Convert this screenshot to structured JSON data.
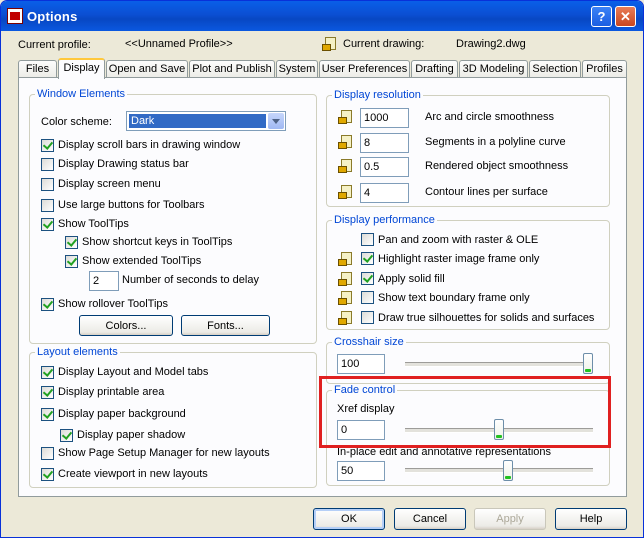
{
  "window": {
    "title": "Options",
    "help_glyph": "?",
    "close_glyph": "✕"
  },
  "profile": {
    "current_profile_label": "Current profile:",
    "current_profile_value": "<<Unnamed Profile>>",
    "current_drawing_label": "Current drawing:",
    "current_drawing_value": "Drawing2.dwg"
  },
  "tabs": [
    {
      "label": "Files"
    },
    {
      "label": "Display"
    },
    {
      "label": "Open and Save"
    },
    {
      "label": "Plot and Publish"
    },
    {
      "label": "System"
    },
    {
      "label": "User Preferences"
    },
    {
      "label": "Drafting"
    },
    {
      "label": "3D Modeling"
    },
    {
      "label": "Selection"
    },
    {
      "label": "Profiles"
    }
  ],
  "window_elements": {
    "title": "Window Elements",
    "color_scheme_label": "Color scheme:",
    "color_scheme_value": "Dark",
    "items": [
      {
        "label": "Display scroll bars in drawing window",
        "checked": true
      },
      {
        "label": "Display Drawing status bar",
        "checked": false
      },
      {
        "label": "Display screen menu",
        "checked": false
      },
      {
        "label": "Use large buttons for Toolbars",
        "checked": false
      },
      {
        "label": "Show ToolTips",
        "checked": true
      },
      {
        "label": "Show shortcut keys in ToolTips",
        "checked": true
      },
      {
        "label": "Show extended ToolTips",
        "checked": true
      },
      {
        "label": "Show rollover ToolTips",
        "checked": true
      }
    ],
    "seconds_value": "2",
    "seconds_label": "Number of seconds to delay",
    "colors_button": "Colors...",
    "fonts_button": "Fonts..."
  },
  "layout_elements": {
    "title": "Layout elements",
    "items": [
      {
        "label": "Display Layout and Model tabs",
        "checked": true
      },
      {
        "label": "Display printable area",
        "checked": true
      },
      {
        "label": "Display paper background",
        "checked": true
      },
      {
        "label": "Display paper shadow",
        "checked": true
      },
      {
        "label": "Show Page Setup Manager for new layouts",
        "checked": false
      },
      {
        "label": "Create viewport in new layouts",
        "checked": true
      }
    ]
  },
  "display_resolution": {
    "title": "Display resolution",
    "items": [
      {
        "value": "1000",
        "label": "Arc and circle smoothness"
      },
      {
        "value": "8",
        "label": "Segments in a polyline curve"
      },
      {
        "value": "0.5",
        "label": "Rendered object smoothness"
      },
      {
        "value": "4",
        "label": "Contour lines per surface"
      }
    ]
  },
  "display_performance": {
    "title": "Display performance",
    "items": [
      {
        "label": "Pan and zoom with raster & OLE",
        "checked": false
      },
      {
        "label": "Highlight raster image frame only",
        "checked": true
      },
      {
        "label": "Apply solid fill",
        "checked": true
      },
      {
        "label": "Show text boundary frame only",
        "checked": false
      },
      {
        "label": "Draw true silhouettes for solids and surfaces",
        "checked": false
      }
    ]
  },
  "crosshair": {
    "title": "Crosshair size",
    "value": "100",
    "level_percent": 100
  },
  "fade_control": {
    "title": "Fade control",
    "xref_label": "Xref display",
    "xref_value": "0",
    "xref_level_percent": 50,
    "inplace_label": "In-place edit and annotative representations",
    "inplace_value": "50",
    "inplace_level_percent": 55
  },
  "buttons": {
    "ok": "OK",
    "cancel": "Cancel",
    "apply": "Apply",
    "help": "Help"
  }
}
